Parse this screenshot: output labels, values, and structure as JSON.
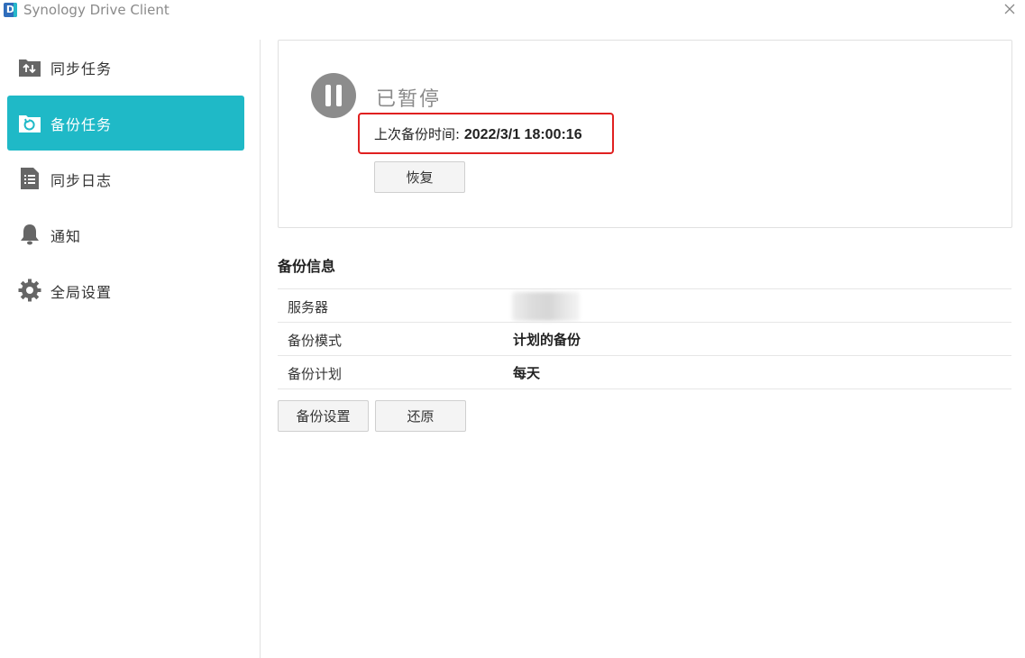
{
  "window": {
    "title": "Synology Drive Client",
    "logo_letter": "D"
  },
  "sidebar": {
    "items": [
      {
        "label": "同步任务",
        "icon": "sync-arrows-icon",
        "active": false
      },
      {
        "label": "备份任务",
        "icon": "backup-folder-icon",
        "active": true
      },
      {
        "label": "同步日志",
        "icon": "log-list-icon",
        "active": false
      },
      {
        "label": "通知",
        "icon": "bell-icon",
        "active": false
      },
      {
        "label": "全局设置",
        "icon": "gear-icon",
        "active": false
      }
    ]
  },
  "status": {
    "title": "已暂停",
    "last_backup_label": "上次备份时间: ",
    "last_backup_value": "2022/3/1 18:00:16",
    "resume_label": "恢复"
  },
  "info": {
    "title": "备份信息",
    "rows": [
      {
        "label": "服务器",
        "value": ""
      },
      {
        "label": "备份模式",
        "value": "计划的备份"
      },
      {
        "label": "备份计划",
        "value": "每天"
      }
    ]
  },
  "actions": {
    "settings_label": "备份设置",
    "restore_label": "还原"
  },
  "colors": {
    "accent": "#1fb9c7",
    "highlight": "#e02020",
    "icon_gray": "#666666"
  }
}
